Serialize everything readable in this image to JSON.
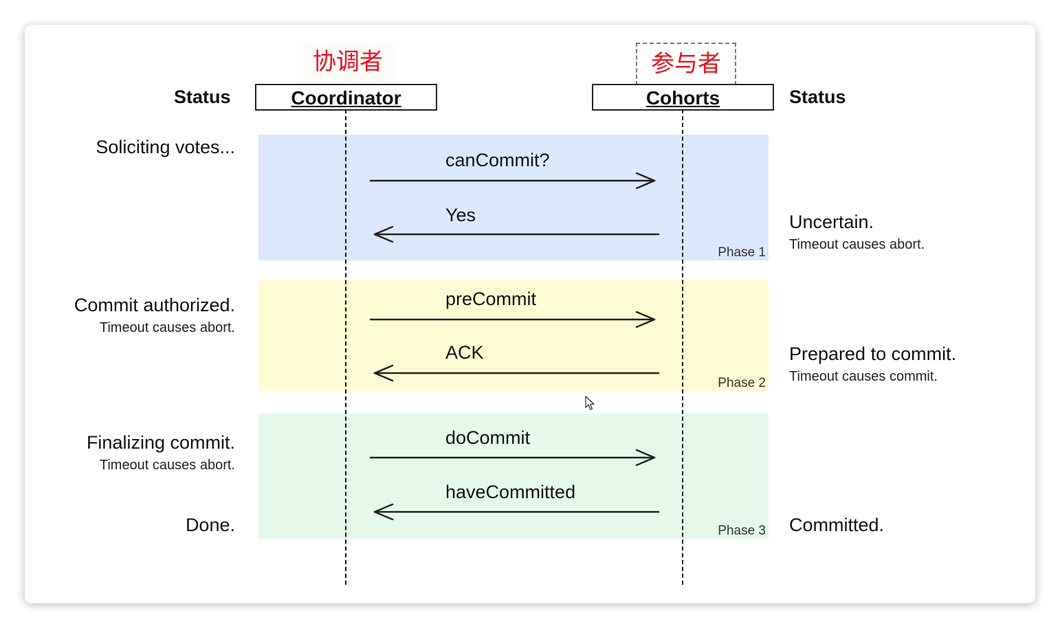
{
  "labels_cn": {
    "coordinator": "协调者",
    "cohort": "参与者"
  },
  "actors": {
    "coordinator": "Coordinator",
    "cohort": "Cohorts"
  },
  "status_heading": "Status",
  "phases": [
    {
      "label": "Phase 1",
      "color": "#dbe8fc"
    },
    {
      "label": "Phase 2",
      "color": "#fdfbd2"
    },
    {
      "label": "Phase 3",
      "color": "#e4f9e9"
    }
  ],
  "messages": [
    {
      "text": "canCommit?",
      "direction": "to-cohort"
    },
    {
      "text": "Yes",
      "direction": "to-coordinator"
    },
    {
      "text": "preCommit",
      "direction": "to-cohort"
    },
    {
      "text": "ACK",
      "direction": "to-coordinator"
    },
    {
      "text": "doCommit",
      "direction": "to-cohort"
    },
    {
      "text": "haveCommitted",
      "direction": "to-coordinator"
    }
  ],
  "coordinator_status": [
    {
      "main": "Soliciting votes...",
      "sub": ""
    },
    {
      "main": "Commit authorized.",
      "sub": "Timeout causes abort."
    },
    {
      "main": "Finalizing commit.",
      "sub": "Timeout causes abort."
    },
    {
      "main": "Done.",
      "sub": ""
    }
  ],
  "cohort_status": [
    {
      "main": "Uncertain.",
      "sub": "Timeout causes abort."
    },
    {
      "main": "Prepared to commit.",
      "sub": "Timeout causes commit."
    },
    {
      "main": "Committed.",
      "sub": ""
    }
  ],
  "icons": {
    "cursor": "mouse-pointer-icon"
  }
}
